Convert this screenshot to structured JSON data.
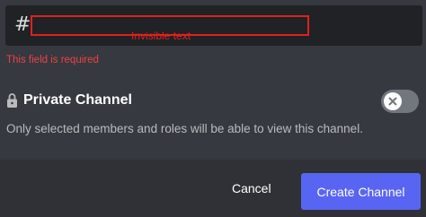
{
  "channel_name_field": {
    "prefix": "#",
    "value": "",
    "annotation_text": "Invisible text",
    "error_text": "This field is required"
  },
  "private_channel": {
    "label": "Private Channel",
    "description": "Only selected members and roles will be able to view this channel.",
    "enabled": false
  },
  "footer": {
    "cancel_label": "Cancel",
    "create_label": "Create Channel"
  },
  "colors": {
    "background": "#36393f",
    "input_background": "#202225",
    "footer_background": "#2f3136",
    "error": "#ed4245",
    "annotation_red": "#e02020",
    "primary_button": "#5865f2",
    "toggle_off": "#72767d"
  },
  "icons": {
    "hash": "hash-icon",
    "lock": "lock-icon",
    "toggle_knob": "close-icon"
  }
}
